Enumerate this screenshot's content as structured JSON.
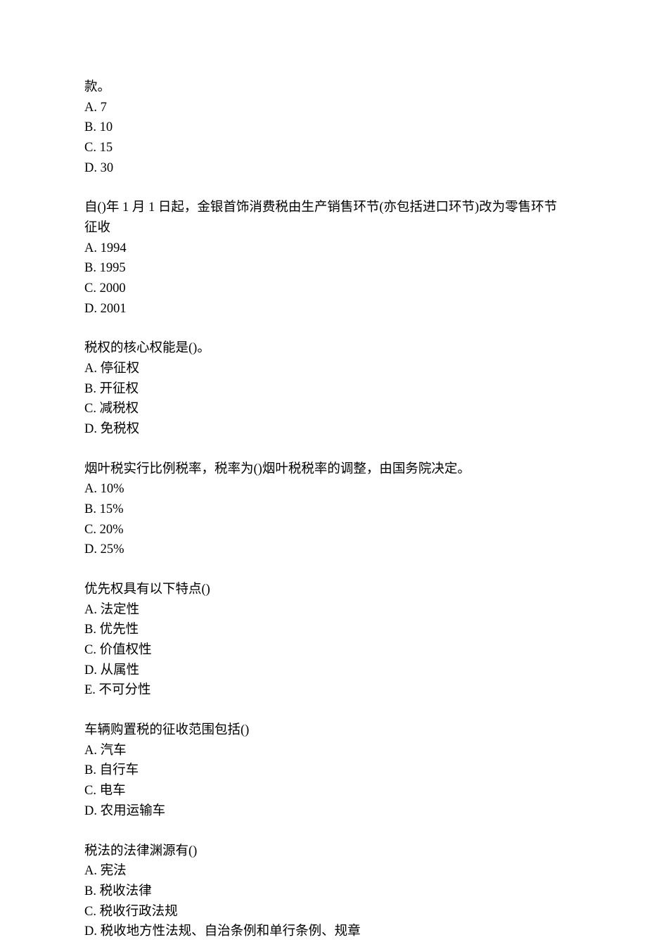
{
  "questions": [
    {
      "text_lines": [
        "款。"
      ],
      "options": [
        "A. 7",
        "B. 10",
        "C. 15",
        "D. 30"
      ]
    },
    {
      "text_lines": [
        "自()年 1 月 1 日起，金银首饰消费税由生产销售环节(亦包括进口环节)改为零售环节征收"
      ],
      "options": [
        "A. 1994",
        "B. 1995",
        "C. 2000",
        "D. 2001"
      ]
    },
    {
      "text_lines": [
        "税权的核心权能是()。"
      ],
      "options": [
        "A. 停征权",
        "B. 开征权",
        "C. 减税权",
        "D. 免税权"
      ]
    },
    {
      "text_lines": [
        "烟叶税实行比例税率，税率为()烟叶税税率的调整，由国务院决定。"
      ],
      "options": [
        "A. 10%",
        "B. 15%",
        "C. 20%",
        "D. 25%"
      ]
    },
    {
      "text_lines": [
        "优先权具有以下特点()"
      ],
      "options": [
        "A. 法定性",
        "B. 优先性",
        "C. 价值权性",
        "D. 从属性",
        "E. 不可分性"
      ]
    },
    {
      "text_lines": [
        "车辆购置税的征收范围包括()"
      ],
      "options": [
        "A. 汽车",
        "B. 自行车",
        "C. 电车",
        "D. 农用运输车"
      ]
    },
    {
      "text_lines": [
        "税法的法律渊源有()"
      ],
      "options": [
        "A. 宪法",
        "B. 税收法律",
        "C. 税收行政法规",
        "D. 税收地方性法规、自治条例和单行条例、规章"
      ]
    }
  ]
}
